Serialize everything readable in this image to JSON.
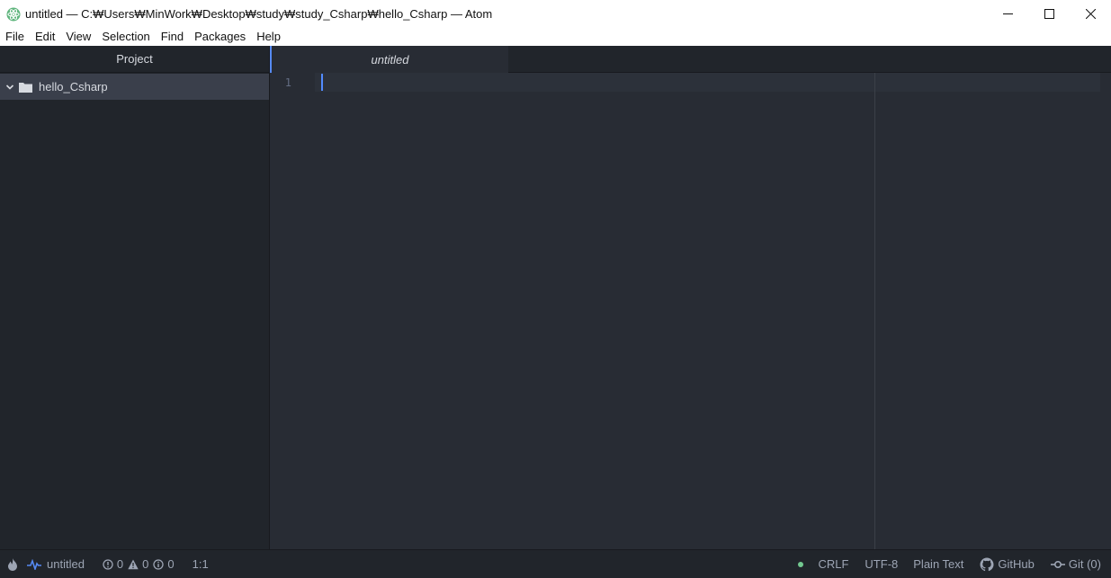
{
  "window": {
    "title": "untitled — C:₩Users₩MinWork₩Desktop₩study₩study_Csharp₩hello_Csharp — Atom"
  },
  "menu": [
    "File",
    "Edit",
    "View",
    "Selection",
    "Find",
    "Packages",
    "Help"
  ],
  "sidebar": {
    "header": "Project",
    "root_folder": "hello_Csharp"
  },
  "tabs": [
    {
      "label": "untitled",
      "active": true
    }
  ],
  "editor": {
    "line_numbers": [
      "1"
    ]
  },
  "statusbar": {
    "file_name": "untitled",
    "errors": "0",
    "warnings": "0",
    "infos": "0",
    "cursor_position": "1:1",
    "line_ending": "CRLF",
    "encoding": "UTF-8",
    "grammar": "Plain Text",
    "github_label": "GitHub",
    "git_label": "Git (0)"
  },
  "colors": {
    "accent": "#568af2",
    "cursor": "#528bff",
    "status_ok": "#73c990",
    "panel_bg": "#21252b",
    "editor_bg": "#282c34"
  },
  "icons": {
    "app": "atom-icon",
    "minimize": "minimize-icon",
    "maximize": "maximize-icon",
    "close": "close-icon",
    "chevron": "chevron-down-icon",
    "folder": "folder-icon",
    "flame": "flame-icon",
    "pulse": "pulse-icon",
    "error": "error-circle-icon",
    "warning": "warning-triangle-icon",
    "info": "info-circle-icon",
    "github": "github-icon",
    "git": "git-commit-icon"
  }
}
